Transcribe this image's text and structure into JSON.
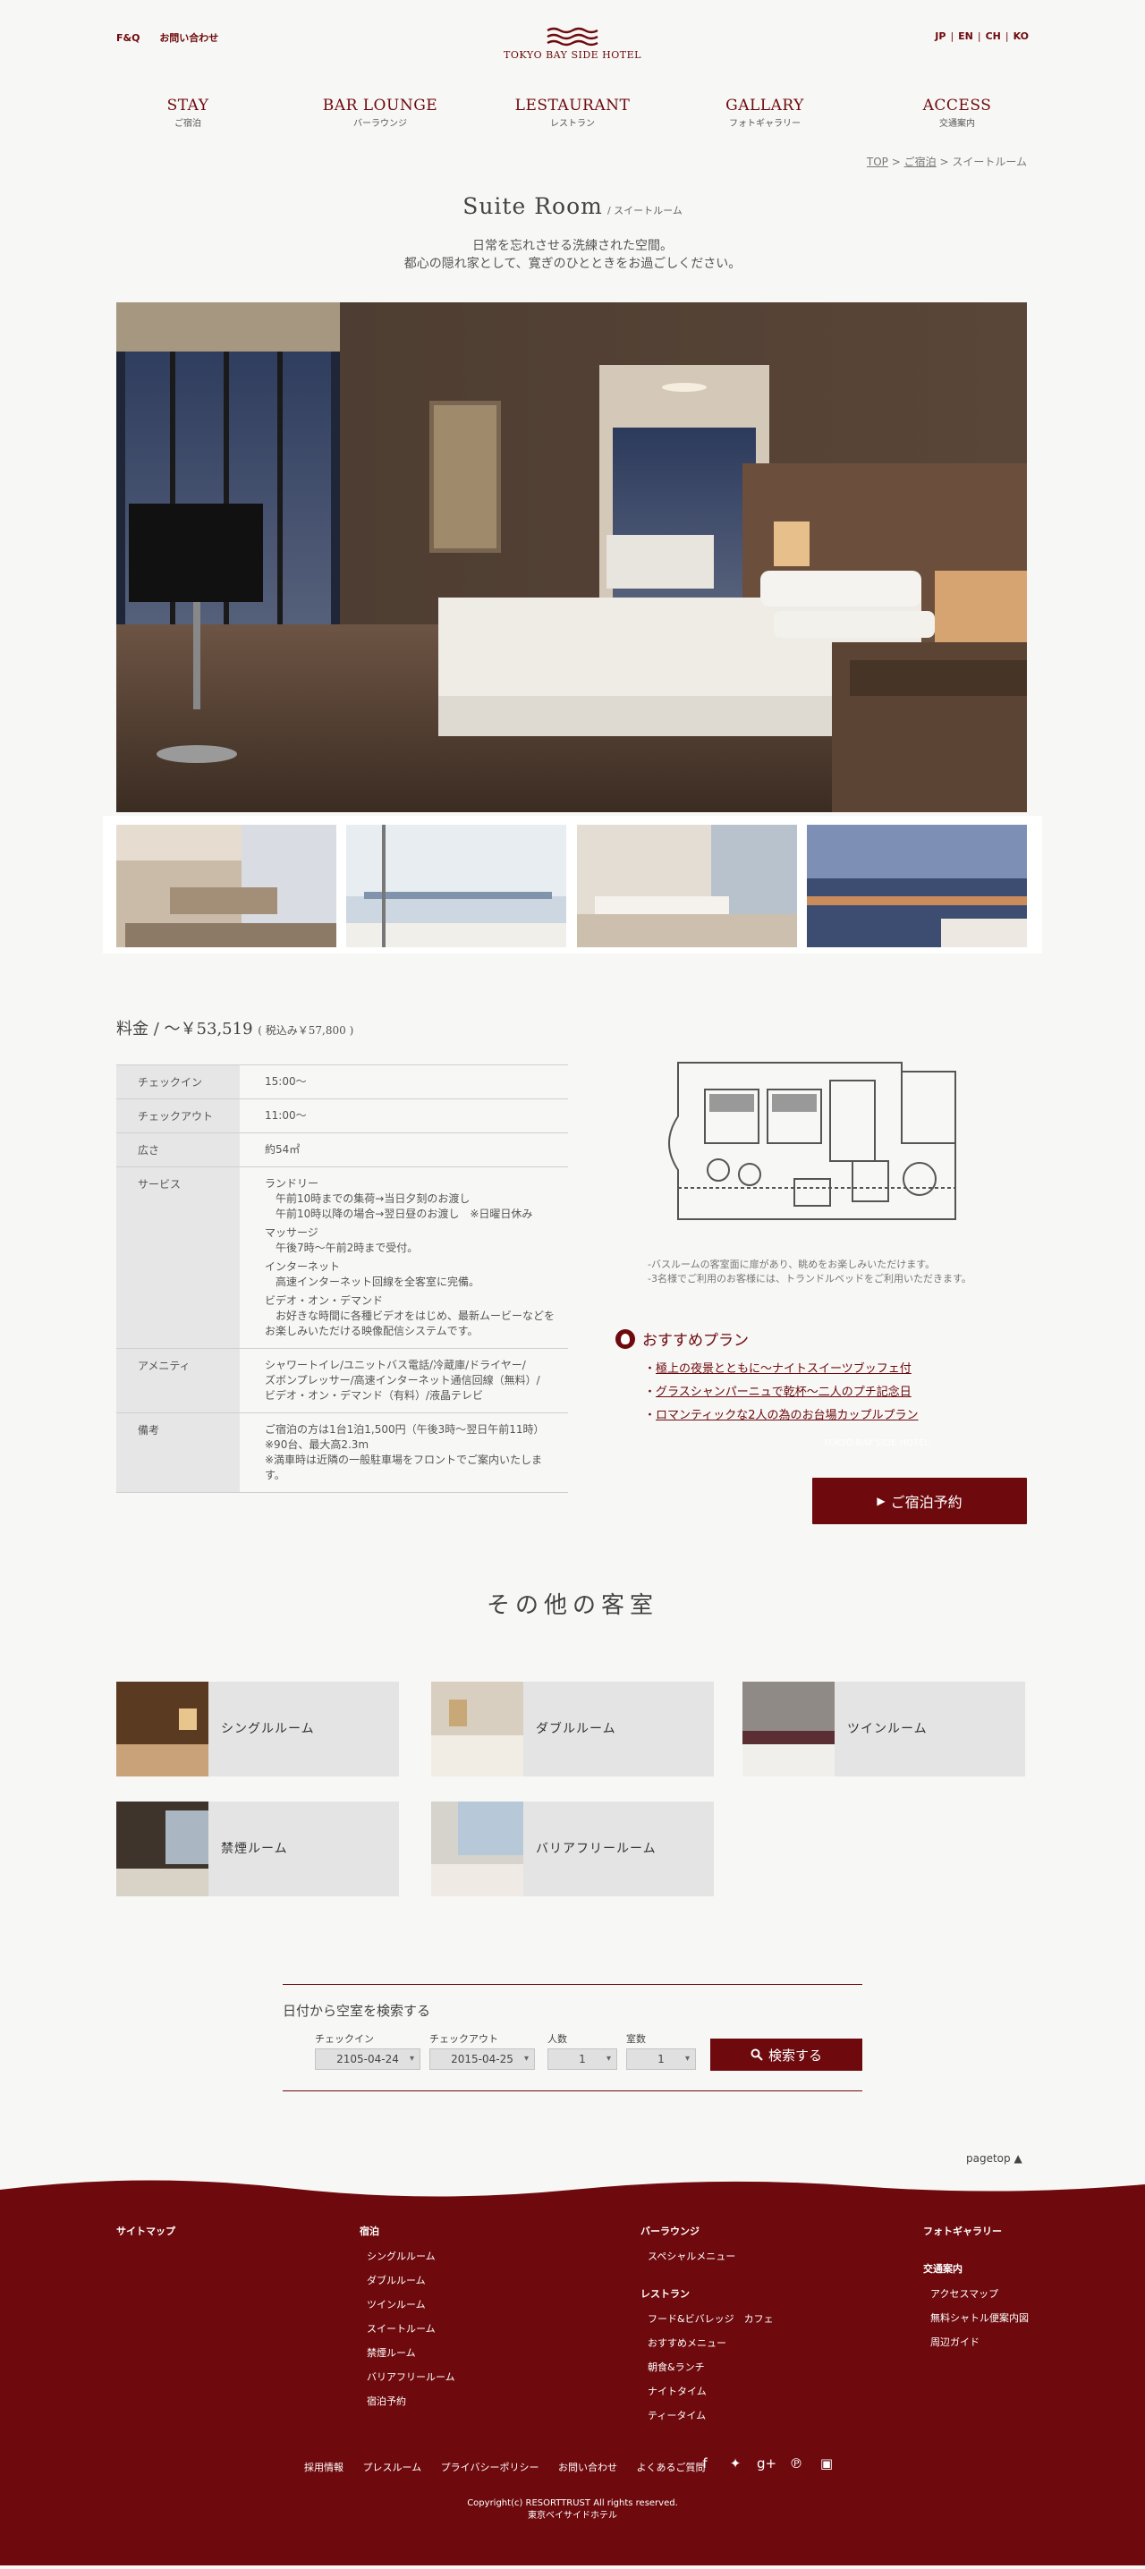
{
  "header": {
    "links": [
      "F&Q",
      "お問い合わせ"
    ],
    "logo_text": "TOKYO BAY SIDE HOTEL",
    "langs": [
      "JP",
      "EN",
      "CH",
      "KO"
    ],
    "nav": [
      {
        "en": "STAY",
        "ja": "ご宿泊"
      },
      {
        "en": "BAR LOUNGE",
        "ja": "バーラウンジ"
      },
      {
        "en": "LESTAURANT",
        "ja": "レストラン"
      },
      {
        "en": "GALLARY",
        "ja": "フォトギャラリー"
      },
      {
        "en": "ACCESS",
        "ja": "交通案内"
      }
    ],
    "breadcrumb": {
      "top": "TOP",
      "stay": "ご宿泊",
      "sep": ">",
      "current": "スイートルーム"
    }
  },
  "page": {
    "title": "Suite Room",
    "subtitle": "/ スイートルーム",
    "lead1": "日常を忘れさせる洗練された空間。",
    "lead2": "都心の隠れ家として、寛ぎのひとときをお過ごしください。"
  },
  "price": {
    "label": "料金",
    "sep": "/",
    "value": "〜￥53,519",
    "tax": "( 税込み￥57,800 )"
  },
  "spec": {
    "checkin_label": "チェックイン",
    "checkin": "15:00〜",
    "checkout_label": "チェックアウト",
    "checkout": "11:00〜",
    "size_label": "広さ",
    "size": "約54㎡",
    "service_label": "サービス",
    "service": [
      "ランドリー",
      "午前10時までの集荷→当日夕刻のお渡し",
      "午前10時以降の場合→翌日昼のお渡し　※日曜日休み",
      "マッサージ",
      "午後7時〜午前2時まで受付。",
      "インターネット",
      "高速インターネット回線を全客室に完備。",
      "ビデオ・オン・デマンド",
      "お好きな時間に各種ビデオをはじめ、最新ムービーなどを",
      "お楽しみいただける映像配信システムです。"
    ],
    "amenity_label": "アメニティ",
    "amenity": [
      "シャワートイレ/ユニットバス電話/冷蔵庫/ドライヤー/",
      "ズボンプレッサー/高速インターネット通信回線（無料）/",
      "ビデオ・オン・デマンド（有料）/液晶テレビ"
    ],
    "remarks_label": "備考",
    "remarks": [
      "ご宿泊の方は1台1泊1,500円（午後3時〜翌日午前11時）",
      "※90台、最大高2.3m",
      "※満車時は近隣の一般駐車場をフロントでご案内いたします。"
    ]
  },
  "notes": [
    "-バスルームの客室面に扉があり、眺めをお楽しみいただけます。",
    "-3名様でご利用のお客様には、トランドルベッドをご利用いただきます。"
  ],
  "plans": {
    "heading": "おすすめプラン",
    "items": [
      "極上の夜景とともに〜ナイトスイーツブッフェ付",
      "グラスシャンパーニュで乾杯〜二人のプチ記念日",
      "ロマンティックな2人の為のお台場カップルプラン"
    ]
  },
  "ghost_text": "TOKYO BAY SIDE HOTEL",
  "book_label": "ご宿泊予約",
  "others": {
    "heading": "その他の客室",
    "rooms": [
      "シングルルーム",
      "ダブルルーム",
      "ツインルーム",
      "禁煙ルーム",
      "バリアフリールーム"
    ]
  },
  "search": {
    "heading": "日付から空室を検索する",
    "checkin_label": "チェックイン",
    "checkin_value": "2105-04-24",
    "checkout_label": "チェックアウト",
    "checkout_value": "2015-04-25",
    "people_label": "人数",
    "people_value": "1",
    "rooms_label": "室数",
    "rooms_value": "1",
    "button": "検索する"
  },
  "pagetop": "pagetop ▲",
  "footer": {
    "sitemap": "サイトマップ",
    "stay_head": "宿泊",
    "stay_items": [
      "シングルルーム",
      "ダブルルーム",
      "ツインルーム",
      "スイートルーム",
      "禁煙ルーム",
      "バリアフリールーム",
      "宿泊予約"
    ],
    "bar_head": "バーラウンジ",
    "bar_items": [
      "スペシャルメニュー"
    ],
    "rest_head": "レストラン",
    "rest_items": [
      "フード&ビバレッジ　カフェ",
      "おすすめメニュー",
      "朝食&ランチ",
      "ナイトタイム",
      "ティータイム"
    ],
    "photo_head": "フォトギャラリー",
    "access_head": "交通案内",
    "access_items": [
      "アクセスマップ",
      "無料シャトル便案内図",
      "周辺ガイド"
    ],
    "bottom_links": [
      "採用情報",
      "プレスルーム",
      "プライバシーポリシー",
      "お問い合わせ",
      "よくあるご質問"
    ],
    "copyright": "Copyright(c) RESORTTRUST All rights reserved.",
    "hotel": "東京ベイサイドホテル"
  },
  "colors": {
    "brand": "#6e0a0d",
    "background": "#f7f7f5",
    "table_head": "#e6e6e6"
  }
}
